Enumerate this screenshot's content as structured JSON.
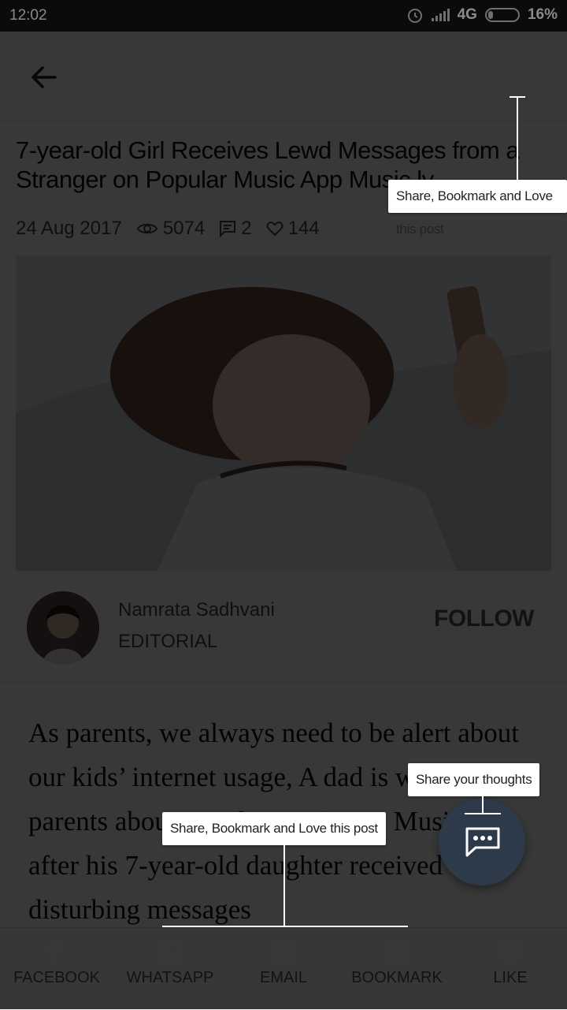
{
  "status_bar": {
    "time": "12:02",
    "network": "4G",
    "battery": "16%"
  },
  "article": {
    "title": "7-year-old Girl Receives Lewd Messages from a Stranger on Popular Music App Music.ly",
    "date": "24 Aug 2017",
    "views": "5074",
    "comments": "2",
    "likes": "144",
    "body": "As parents, we always need to be alert about our kids’ internet usage, A dad is warning parents about popular music app Music.ly after his 7-year-old daughter received disturbing messages"
  },
  "author": {
    "name": "Namrata Sadhvani",
    "role": "EDITORIAL",
    "follow_label": "FOLLOW"
  },
  "bottom_bar": {
    "items": [
      {
        "label": "FACEBOOK",
        "icon": "facebook-icon"
      },
      {
        "label": "WHATSAPP",
        "icon": "whatsapp-icon"
      },
      {
        "label": "EMAIL",
        "icon": "email-icon"
      },
      {
        "label": "BOOKMARK",
        "icon": "bookmark-icon"
      },
      {
        "label": "LIKE",
        "icon": "heart-icon"
      }
    ]
  },
  "tooltips": {
    "top": "Share, Bookmark and Love this post",
    "bottom": "Share, Bookmark and Love this post",
    "fab": "Share your thoughts"
  },
  "colors": {
    "fab": "#2d3a4a",
    "overlay": "rgba(0,0,0,0.78)"
  }
}
